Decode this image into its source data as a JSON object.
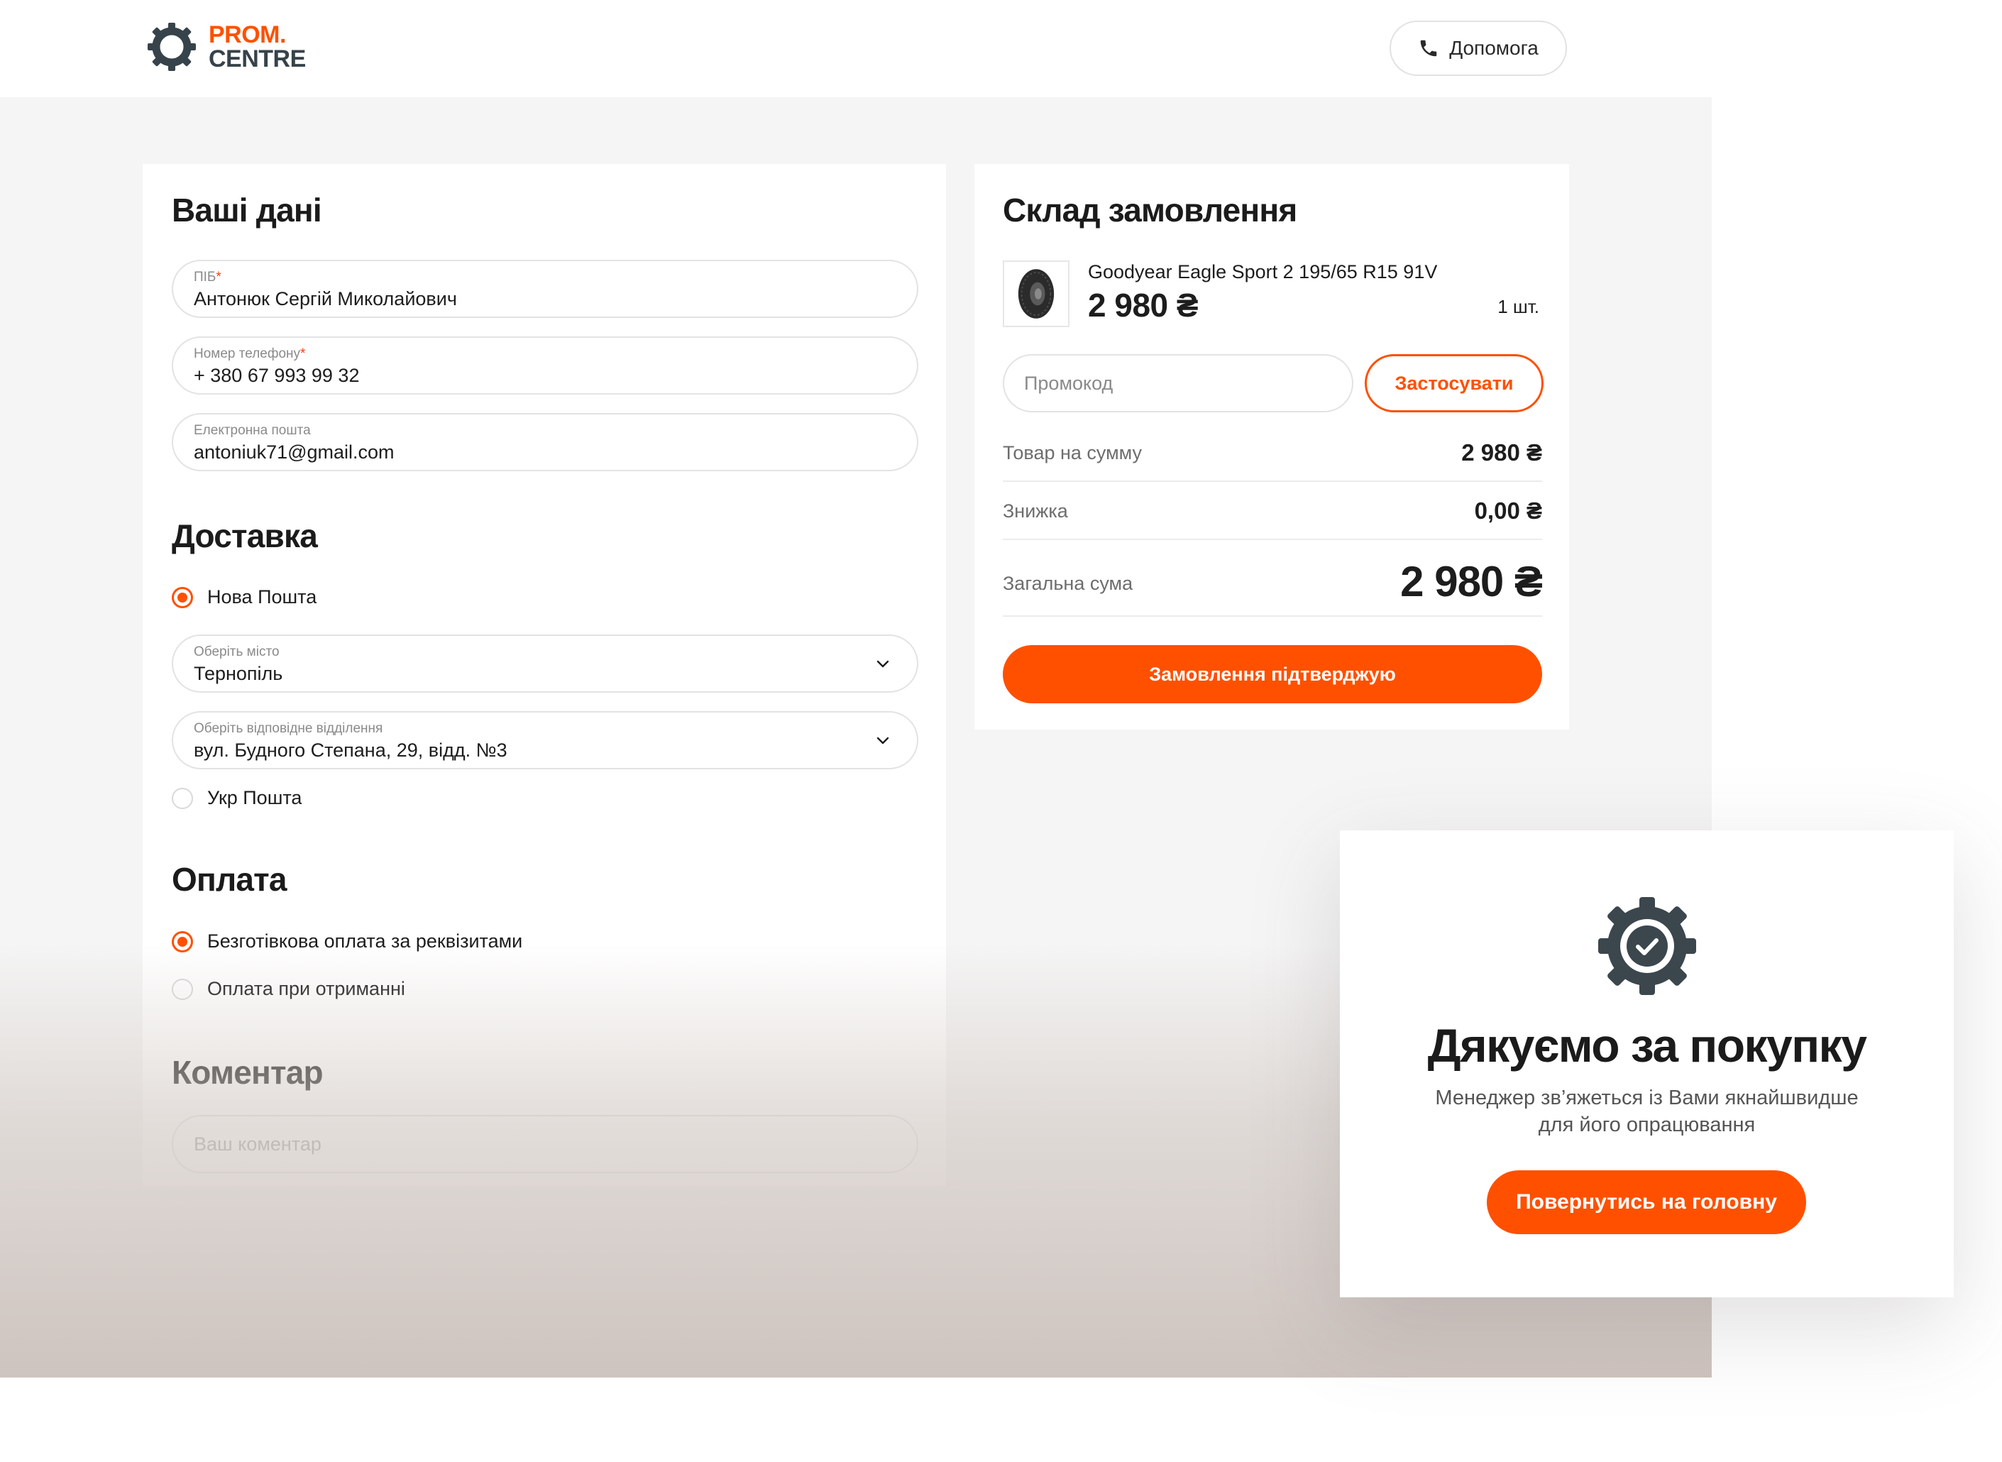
{
  "header": {
    "logo_line1": "PROM.",
    "logo_line2": "CENTRE",
    "help_label": "Допомога"
  },
  "customer": {
    "title": "Ваші дані",
    "name_label": "ПІБ",
    "name_value": "Антонюк Сергій Миколайович",
    "phone_label": "Номер телефону",
    "phone_value": "+ 380 67 993 99 32",
    "email_label": "Електронна пошта",
    "email_value": "antoniuk71@gmail.com",
    "required_mark": "*"
  },
  "delivery": {
    "title": "Доставка",
    "option1": "Нова Пошта",
    "city_label": "Оберіть місто",
    "city_value": "Тернопіль",
    "branch_label": "Оберіть відповідне відділення",
    "branch_value": "вул. Будного Степана, 29, відд. №3",
    "option2": "Укр Пошта"
  },
  "payment": {
    "title": "Оплата",
    "option1": "Безготівкова оплата за реквізитами",
    "option2": "Оплата при отриманні"
  },
  "comment": {
    "title": "Коментар",
    "placeholder": "Ваш коментар"
  },
  "order": {
    "title": "Склад замовлення",
    "product_name": "Goodyear Eagle Sport 2 195/65 R15 91V",
    "product_price": "2 980 ₴",
    "product_qty": "1 шт.",
    "promo_placeholder": "Промокод",
    "apply_label": "Застосувати",
    "subtotal_label": "Товар на сумму",
    "subtotal_value": "2 980 ₴",
    "discount_label": "Знижка",
    "discount_value": "0,00 ₴",
    "total_label": "Загальна сума",
    "total_value": "2 980 ₴",
    "confirm_label": "Замовлення підтверджую"
  },
  "modal": {
    "title": "Дякуємо за покупку",
    "subtitle_line1": "Менеджер зв’яжеться із Вами якнайшвидше",
    "subtitle_line2": "для його опрацювання",
    "button_label": "Повернутись на головну"
  },
  "colors": {
    "accent": "#ff5000",
    "logo_dark": "#37434a",
    "icon_dark": "#3b474d"
  },
  "icons": {
    "logo": "gear-ring-logo",
    "help": "phone-icon",
    "select": "chevron-down-icon",
    "product": "tire-icon",
    "success": "gear-check-icon"
  }
}
